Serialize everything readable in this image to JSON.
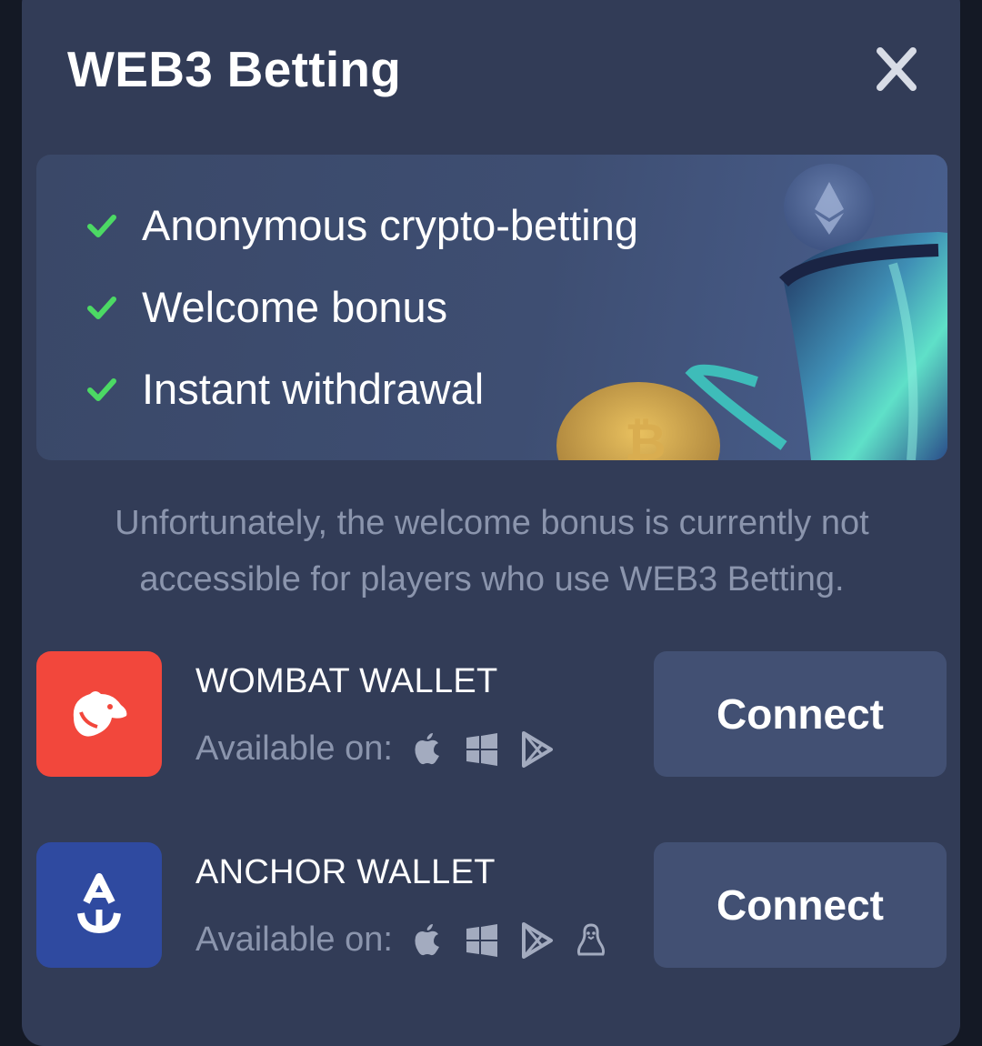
{
  "modal": {
    "title": "WEB3 Betting"
  },
  "features": [
    "Anonymous crypto-betting",
    "Welcome bonus",
    "Instant withdrawal"
  ],
  "notice": "Unfortunately, the welcome bonus is currently not accessible for players who use WEB3 Betting.",
  "wallets": [
    {
      "name": "WOMBAT WALLET",
      "available_label": "Available on:",
      "platforms": [
        "apple-icon",
        "windows-icon",
        "google-play-icon"
      ],
      "connect_label": "Connect",
      "logo_color": "#f2473c"
    },
    {
      "name": "ANCHOR WALLET",
      "available_label": "Available on:",
      "platforms": [
        "apple-icon",
        "windows-icon",
        "google-play-icon",
        "linux-icon"
      ],
      "connect_label": "Connect",
      "logo_color": "#2f4aa0"
    }
  ],
  "colors": {
    "modal_bg": "#323c57",
    "button_bg": "#425073",
    "check_green": "#4cd964",
    "muted_text": "#8b95ad"
  }
}
